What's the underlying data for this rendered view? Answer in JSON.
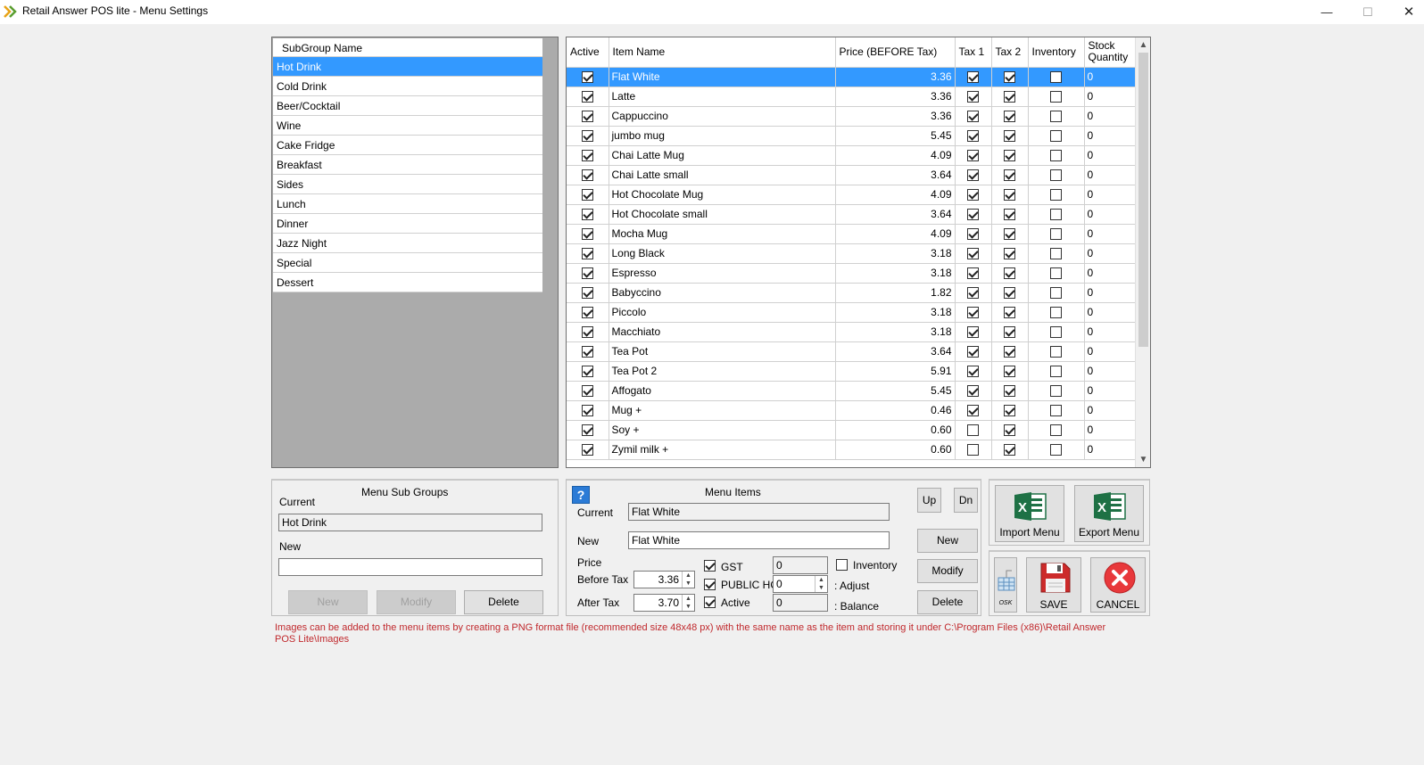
{
  "window": {
    "title": "Retail Answer POS lite - Menu Settings",
    "min_symbol": "—",
    "max_symbol": "☐",
    "close_symbol": "✕"
  },
  "subgroups": {
    "header": "SubGroup Name",
    "items": [
      "Hot Drink",
      "Cold Drink",
      "Beer/Cocktail",
      "Wine",
      "Cake Fridge",
      "Breakfast",
      "Sides",
      "Lunch",
      "Dinner",
      "Jazz Night",
      "Special",
      "Dessert"
    ],
    "selected_index": 0
  },
  "items_table": {
    "headers": {
      "active": "Active",
      "item_name": "Item Name",
      "price": "Price (BEFORE Tax)",
      "tax1": "Tax 1",
      "tax2": "Tax 2",
      "inventory": "Inventory",
      "stock": "Stock Quantity"
    },
    "rows": [
      {
        "active": true,
        "name": "Flat White",
        "price": "3.36",
        "tax1": true,
        "tax2": true,
        "inventory": false,
        "stock": "0"
      },
      {
        "active": true,
        "name": "Latte",
        "price": "3.36",
        "tax1": true,
        "tax2": true,
        "inventory": false,
        "stock": "0"
      },
      {
        "active": true,
        "name": "Cappuccino",
        "price": "3.36",
        "tax1": true,
        "tax2": true,
        "inventory": false,
        "stock": "0"
      },
      {
        "active": true,
        "name": "jumbo mug",
        "price": "5.45",
        "tax1": true,
        "tax2": true,
        "inventory": false,
        "stock": "0"
      },
      {
        "active": true,
        "name": "Chai Latte Mug",
        "price": "4.09",
        "tax1": true,
        "tax2": true,
        "inventory": false,
        "stock": "0"
      },
      {
        "active": true,
        "name": "Chai Latte small",
        "price": "3.64",
        "tax1": true,
        "tax2": true,
        "inventory": false,
        "stock": "0"
      },
      {
        "active": true,
        "name": "Hot Chocolate Mug",
        "price": "4.09",
        "tax1": true,
        "tax2": true,
        "inventory": false,
        "stock": "0"
      },
      {
        "active": true,
        "name": "Hot Chocolate small",
        "price": "3.64",
        "tax1": true,
        "tax2": true,
        "inventory": false,
        "stock": "0"
      },
      {
        "active": true,
        "name": "Mocha Mug",
        "price": "4.09",
        "tax1": true,
        "tax2": true,
        "inventory": false,
        "stock": "0"
      },
      {
        "active": true,
        "name": "Long Black",
        "price": "3.18",
        "tax1": true,
        "tax2": true,
        "inventory": false,
        "stock": "0"
      },
      {
        "active": true,
        "name": "Espresso",
        "price": "3.18",
        "tax1": true,
        "tax2": true,
        "inventory": false,
        "stock": "0"
      },
      {
        "active": true,
        "name": "Babyccino",
        "price": "1.82",
        "tax1": true,
        "tax2": true,
        "inventory": false,
        "stock": "0"
      },
      {
        "active": true,
        "name": "Piccolo",
        "price": "3.18",
        "tax1": true,
        "tax2": true,
        "inventory": false,
        "stock": "0"
      },
      {
        "active": true,
        "name": "Macchiato",
        "price": "3.18",
        "tax1": true,
        "tax2": true,
        "inventory": false,
        "stock": "0"
      },
      {
        "active": true,
        "name": "Tea Pot",
        "price": "3.64",
        "tax1": true,
        "tax2": true,
        "inventory": false,
        "stock": "0"
      },
      {
        "active": true,
        "name": "Tea Pot 2",
        "price": "5.91",
        "tax1": true,
        "tax2": true,
        "inventory": false,
        "stock": "0"
      },
      {
        "active": true,
        "name": "Affogato",
        "price": "5.45",
        "tax1": true,
        "tax2": true,
        "inventory": false,
        "stock": "0"
      },
      {
        "active": true,
        "name": "Mug +",
        "price": "0.46",
        "tax1": true,
        "tax2": true,
        "inventory": false,
        "stock": "0"
      },
      {
        "active": true,
        "name": "Soy +",
        "price": "0.60",
        "tax1": false,
        "tax2": true,
        "inventory": false,
        "stock": "0"
      },
      {
        "active": true,
        "name": "Zymil milk +",
        "price": "0.60",
        "tax1": false,
        "tax2": true,
        "inventory": false,
        "stock": "0"
      }
    ],
    "selected_index": 0,
    "scroll_up_symbol": "▲",
    "scroll_down_symbol": "▼"
  },
  "menu_sub_groups": {
    "title": "Menu Sub Groups",
    "current_label": "Current",
    "current_value": "Hot Drink",
    "new_label": "New",
    "new_value": "",
    "new_button": "New",
    "modify_button": "Modify",
    "delete_button": "Delete"
  },
  "menu_items": {
    "title": "Menu Items",
    "help_symbol": "?",
    "current_label": "Current",
    "current_value": "Flat White",
    "new_label": "New",
    "new_value": "Flat White",
    "price_label": "Price",
    "before_tax_label": "Before Tax",
    "before_tax_value": "3.36",
    "after_tax_label": "After Tax",
    "after_tax_value": "3.70",
    "gst_label": "GST",
    "gst_checked": true,
    "gst_value": "0",
    "public_holiday_label": "PUBLIC HO",
    "public_holiday_checked": true,
    "public_holiday_value": "0",
    "active_label": "Active",
    "active_checked": true,
    "active_value": "0",
    "inventory_label": "Inventory",
    "inventory_checked": false,
    "adjust_label": ": Adjust",
    "balance_label": ": Balance",
    "up_button": "Up",
    "dn_button": "Dn",
    "new_button": "New",
    "modify_button": "Modify",
    "delete_button": "Delete"
  },
  "actions": {
    "import_menu": "Import Menu",
    "export_menu": "Export Menu",
    "osk": "OSK",
    "save": "SAVE",
    "cancel": "CANCEL"
  },
  "note": "Images can be added to the menu items by creating a PNG format file (recommended size 48x48 px) with the same name as the item and storing it under C:\\Program Files (x86)\\Retail Answer POS Lite\\Images",
  "colors": {
    "selection": "#3399ff",
    "note_text": "#c0282c",
    "excel_green": "#1e7145",
    "cancel_red": "#e8383b",
    "save_red": "#cc2a2a"
  },
  "icons": {
    "app": "arrows-icon",
    "help": "help-icon",
    "excel": "excel-icon",
    "keyboard": "keyboard-icon",
    "save": "floppy-disk-icon",
    "cancel": "cancel-x-icon"
  }
}
